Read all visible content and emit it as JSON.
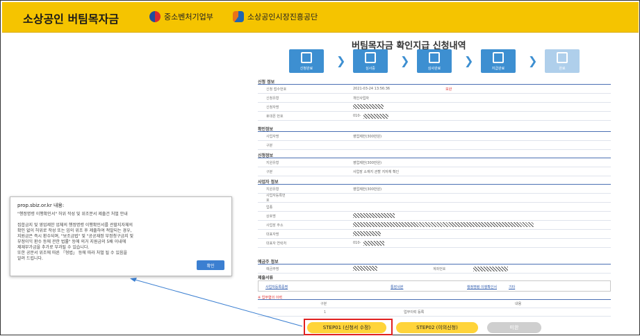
{
  "header": {
    "brand": "소상공인 버팀목자금",
    "logo1": "중소벤처기업부",
    "logo2": "소상공인시장진흥공단"
  },
  "page": {
    "title": "버팀목자금 확인지급 신청내역"
  },
  "steps": [
    {
      "label": "신청완료"
    },
    {
      "label": "심사중"
    },
    {
      "label": "심사완료"
    },
    {
      "label": "지급완료"
    },
    {
      "label": "완료"
    }
  ],
  "dialog": {
    "title": "prop.sbiz.or.kr 내용:",
    "body": "\"행정명령 이행확인서\" 허위 작성 및 위조분서 제출건 처벌 안내\n\n집합금지 및 영업제한 업체의 행정명령 이행확인서를 관할지자체의\n확인 없이 허위로 작성 또는 임의 위조 후 제출하여 적발되는 경우,\n지원금은 즉시 환수되며, \"보조금법\" 및 \"공공재정 부정청구금지 및\n부정이익 환수 등에 관한 법률\" 등에 의거 지원금의 5배 이내에\n제재부가금을 추가로 부과될 수 있습니다.\n또한 공문서 위조에 따른 「형법」 등에 따라 처벌 될 수 있음을\n알려 드립니다.",
    "ok": "확인"
  },
  "buttons": {
    "step1": "STEP01 (신청서 수정)",
    "step2": "STEP02 (이의신청)",
    "done": "미완"
  },
  "sections": {
    "s1": "신청 정보",
    "s2": "확인정보",
    "s3": "신청정보",
    "s4": "사업자 정보",
    "s5": "예금주 정보",
    "s6": "제출서류"
  },
  "values": {
    "date": "2021-03-24 13:56:36",
    "phone_prefix": "010-",
    "status_red": "보완"
  },
  "notice": "※ 업무협의 이력"
}
